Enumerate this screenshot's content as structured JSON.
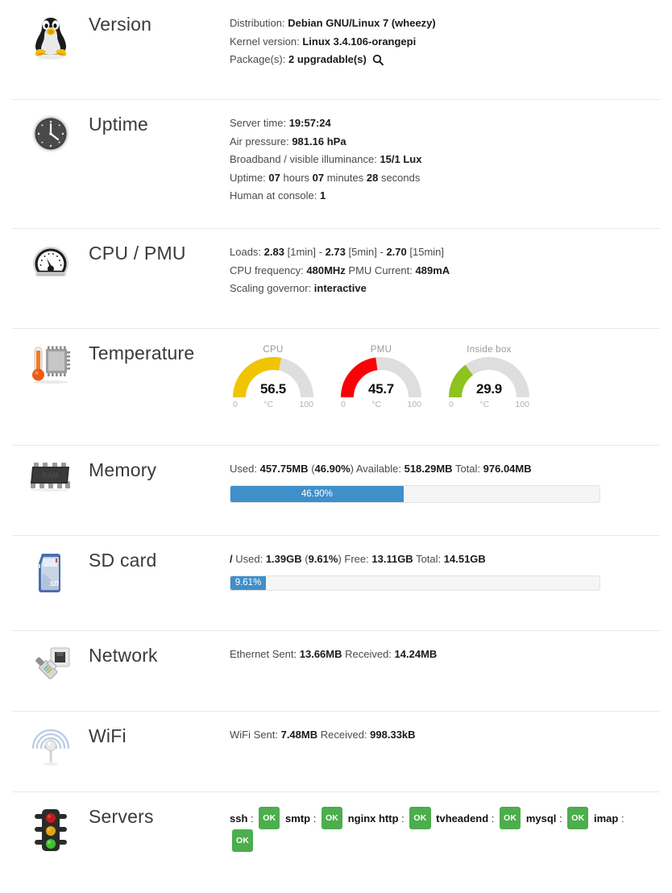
{
  "sections": [
    {
      "id": "version",
      "title": "Version",
      "icon": "linux-penguin-icon",
      "lines": [
        {
          "label": "Distribution:",
          "value": "Debian GNU/Linux 7 (wheezy)"
        },
        {
          "label": "Kernel version:",
          "value": "Linux 3.4.106-orangepi"
        },
        {
          "label": "Package(s):",
          "value": "2 upgradable(s)",
          "icon": "search-icon"
        }
      ]
    },
    {
      "id": "uptime",
      "title": "Uptime",
      "icon": "clock-icon",
      "lines": [
        {
          "label": "Server time:",
          "value": "19:57:24"
        },
        {
          "label": "Air pressure:",
          "value": "981.16 hPa"
        },
        {
          "label": "Broadband / visible illuminance:",
          "value": "15/1 Lux"
        },
        {
          "label": "Uptime:",
          "value": "07",
          "suffix": " hours ",
          "value2": "07",
          "suffix2": " minutes ",
          "value3": "28",
          "suffix3": " seconds"
        },
        {
          "label": "Human at console:",
          "value": "1"
        }
      ]
    },
    {
      "id": "cpu",
      "title": "CPU / PMU",
      "icon": "speedometer-icon",
      "lines": [
        {
          "label": "Loads:",
          "value": "2.83",
          "suffix": " [1min] - ",
          "value2": "2.73",
          "suffix2": " [5min] - ",
          "value3": "2.70",
          "suffix3": " [15min]"
        },
        {
          "label": "CPU frequency:",
          "value": "480MHz",
          "suffix": " PMU Current: ",
          "value2": "489mA"
        },
        {
          "label": "Scaling governor:",
          "value": "interactive"
        }
      ]
    },
    {
      "id": "temperature",
      "title": "Temperature",
      "icon": "thermometer-chip-icon"
    },
    {
      "id": "memory",
      "title": "Memory",
      "icon": "ram-chip-icon",
      "lines": [
        {
          "label": "Used:",
          "value": "457.75MB",
          "suffix": " (",
          "value2": "46.90%",
          "suffix2": ") Available: ",
          "value3": "518.29MB",
          "suffix3": " Total: ",
          "value4": "976.04MB"
        }
      ]
    },
    {
      "id": "sdcard",
      "title": "SD card",
      "icon": "sd-card-icon",
      "lines": [
        {
          "prefix": "/",
          "label": " Used:",
          "value": "1.39GB",
          "suffix": " (",
          "value2": "9.61%",
          "suffix2": ") Free: ",
          "value3": "13.11GB",
          "suffix3": " Total: ",
          "value4": "14.51GB"
        }
      ]
    },
    {
      "id": "network",
      "title": "Network",
      "icon": "ethernet-plug-icon",
      "lines": [
        {
          "label": "Ethernet Sent:",
          "value": "13.66MB",
          "suffix": " Received: ",
          "value2": "14.24MB"
        }
      ]
    },
    {
      "id": "wifi",
      "title": "WiFi",
      "icon": "wifi-antenna-icon",
      "lines": [
        {
          "label": "WiFi Sent:",
          "value": "7.48MB",
          "suffix": " Received: ",
          "value2": "998.33kB"
        }
      ]
    },
    {
      "id": "servers",
      "title": "Servers",
      "icon": "traffic-light-icon"
    }
  ],
  "version": {
    "distribution_label": "Distribution:",
    "distribution_value": "Debian GNU/Linux 7 (wheezy)",
    "kernel_label": "Kernel version:",
    "kernel_value": "Linux 3.4.106-orangepi",
    "packages_label": "Package(s):",
    "packages_value": "2 upgradable(s)"
  },
  "uptime": {
    "server_time_label": "Server time:",
    "server_time_value": "19:57:24",
    "air_pressure_label": "Air pressure:",
    "air_pressure_value": "981.16 hPa",
    "illuminance_label": "Broadband / visible illuminance:",
    "illuminance_value": "15/1 Lux",
    "uptime_label": "Uptime:",
    "uptime_hours": "07",
    "uptime_hours_suffix": " hours ",
    "uptime_minutes": "07",
    "uptime_minutes_suffix": " minutes ",
    "uptime_seconds": "28",
    "uptime_seconds_suffix": " seconds",
    "human_label": "Human at console:",
    "human_value": "1"
  },
  "cpu": {
    "loads_label": "Loads:",
    "load_1min": "2.83",
    "load_1min_suffix": " [1min] - ",
    "load_5min": "2.73",
    "load_5min_suffix": " [5min] - ",
    "load_15min": "2.70",
    "load_15min_suffix": " [15min]",
    "freq_label": "CPU frequency:",
    "freq_value": "480MHz",
    "pmu_label": " PMU Current: ",
    "pmu_value": "489mA",
    "governor_label": "Scaling governor:",
    "governor_value": "interactive"
  },
  "temperature": {
    "unit": "°C",
    "min_tick": "0",
    "max_tick": "100",
    "gauges": [
      {
        "label": "CPU",
        "value": "56.5",
        "percent": 56.5,
        "color": "#f1c400"
      },
      {
        "label": "PMU",
        "value": "45.7",
        "percent": 45.7,
        "color": "#fb0007"
      },
      {
        "label": "Inside box",
        "value": "29.9",
        "percent": 29.9,
        "color": "#8ec21f"
      }
    ]
  },
  "memory": {
    "used_label": "Used:",
    "used_value": "457.75MB",
    "open_paren": " (",
    "percent_value": "46.90%",
    "close_paren": ") Available: ",
    "available_value": "518.29MB",
    "total_label": " Total: ",
    "total_value": "976.04MB",
    "bar_percent": 46.9,
    "bar_text": "46.90%",
    "bar_color": "#3f8fca"
  },
  "sdcard": {
    "mount": "/",
    "used_label": " Used:",
    "used_value": "1.39GB",
    "open_paren": " (",
    "percent_value": "9.61%",
    "close_paren": ") Free: ",
    "free_value": "13.11GB",
    "total_label": " Total: ",
    "total_value": "14.51GB",
    "bar_percent": 9.61,
    "bar_text": "9.61%",
    "bar_color": "#3f8fca"
  },
  "network": {
    "sent_label": "Ethernet Sent:",
    "sent_value": "13.66MB",
    "received_label": " Received: ",
    "received_value": "14.24MB"
  },
  "wifi": {
    "sent_label": "WiFi Sent:",
    "sent_value": "7.48MB",
    "received_label": " Received: ",
    "received_value": "998.33kB"
  },
  "servers": {
    "badge_color": "#4cae4c",
    "items": [
      {
        "name": "ssh",
        "sep": " : ",
        "status": "OK"
      },
      {
        "name": "smtp",
        "sep": " : ",
        "status": "OK"
      },
      {
        "name": "nginx http",
        "sep": " : ",
        "status": "OK"
      },
      {
        "name": "tvheadend",
        "sep": " : ",
        "status": "OK"
      },
      {
        "name": "mysql",
        "sep": " : ",
        "status": "OK"
      },
      {
        "name": "imap",
        "sep": " : ",
        "status": "OK"
      }
    ]
  }
}
